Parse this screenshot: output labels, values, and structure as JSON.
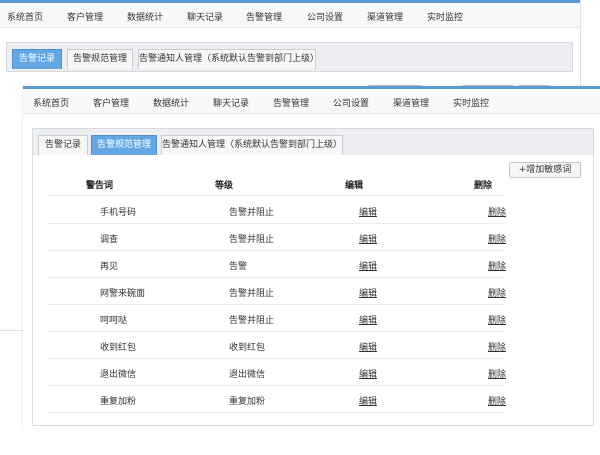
{
  "back_window": {
    "nav": [
      "系统首页",
      "客户管理",
      "数据统计",
      "聊天记录",
      "告警管理",
      "公司设置",
      "渠道管理",
      "实时监控"
    ],
    "tabs": [
      "告警记录",
      "告警规范管理",
      "告警通知人管理（系统默认告警到部门上级）"
    ],
    "active_tab": 0
  },
  "front_window": {
    "nav": [
      "系统首页",
      "客户管理",
      "数据统计",
      "聊天记录",
      "告警管理",
      "公司设置",
      "渠道管理",
      "实时监控"
    ],
    "tabs": [
      "告警记录",
      "告警规范管理",
      "告警通知人管理（系统默认告警到部门上级）"
    ],
    "active_tab": 1,
    "add_button": "+增加敏感词",
    "table": {
      "headers": [
        "警告词",
        "等级",
        "编辑",
        "删除"
      ],
      "rows": [
        {
          "word": "手机号码",
          "level": "告警并阻止",
          "edit": "编辑",
          "del": "删除"
        },
        {
          "word": "调查",
          "level": "告警并阻止",
          "edit": "编辑",
          "del": "删除"
        },
        {
          "word": "再见",
          "level": "告警",
          "edit": "编辑",
          "del": "删除"
        },
        {
          "word": "网警来碗面",
          "level": "告警并阻止",
          "edit": "编辑",
          "del": "删除"
        },
        {
          "word": "呵呵哒",
          "level": "告警并阻止",
          "edit": "编辑",
          "del": "删除"
        },
        {
          "word": "收到红包",
          "level": "收到红包",
          "edit": "编辑",
          "del": "删除"
        },
        {
          "word": "退出微信",
          "level": "退出微信",
          "edit": "编辑",
          "del": "删除"
        },
        {
          "word": "重复加粉",
          "level": "重复加粉",
          "edit": "编辑",
          "del": "删除"
        }
      ]
    }
  }
}
